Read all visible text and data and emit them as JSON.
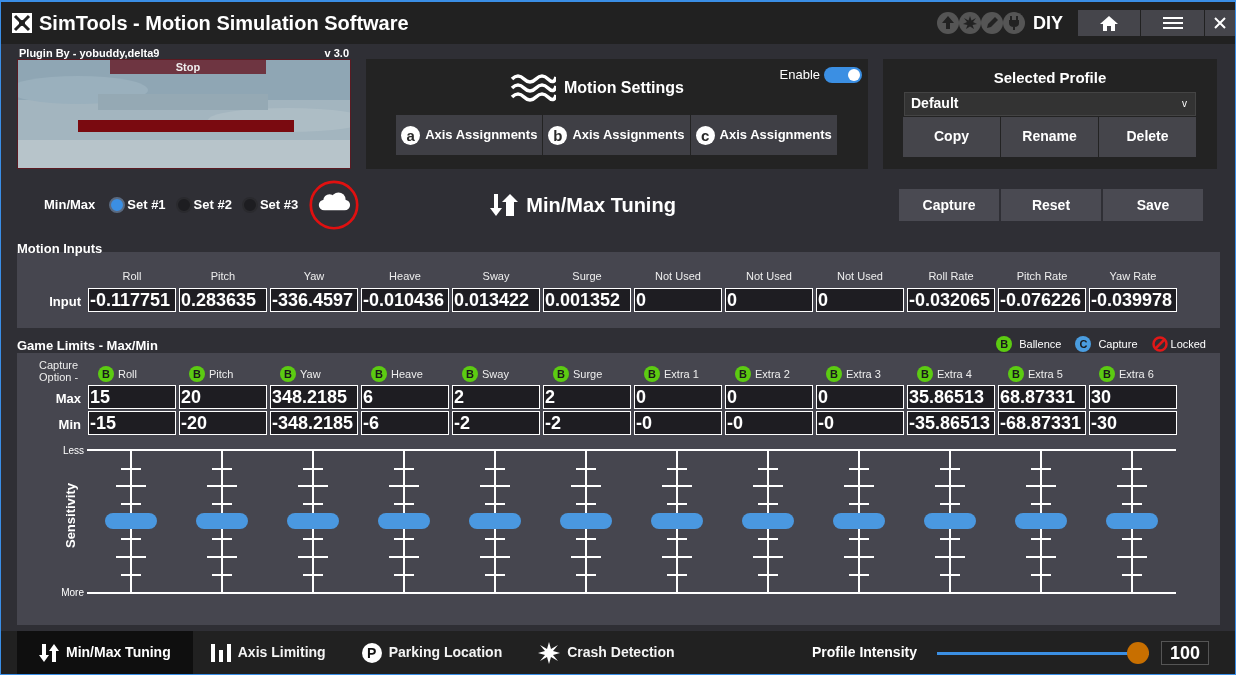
{
  "window": {
    "title": "SimTools - Motion Simulation Software",
    "mode": "DIY"
  },
  "game": {
    "plugin_by": "Plugin By - yobuddy,delta9",
    "version": "v 3.0",
    "stop_button": "Stop",
    "kind": "picture"
  },
  "motion_settings": {
    "title": "Motion Settings",
    "enable": {
      "label": "Enable",
      "on": true
    },
    "axis_buttons": [
      {
        "badge": "a",
        "label": "Axis Assignments"
      },
      {
        "badge": "b",
        "label": "Axis Assignments"
      },
      {
        "badge": "c",
        "label": "Axis Assignments"
      }
    ]
  },
  "profile": {
    "title": "Selected Profile",
    "dropdown": {
      "value": "Default",
      "caret": "v"
    },
    "buttons": [
      "Copy",
      "Rename",
      "Delete"
    ]
  },
  "min_max": {
    "label": "Min/Max",
    "sets": [
      {
        "label": "Set #1",
        "selected": true
      },
      {
        "label": "Set #2",
        "selected": false
      },
      {
        "label": "Set #3",
        "selected": false
      }
    ]
  },
  "section_title": "Min/Max Tuning",
  "actions": [
    "Capture",
    "Reset",
    "Save"
  ],
  "motion_inputs": {
    "title": "Motion Inputs",
    "row_label": "Input",
    "columns": [
      {
        "label": "Roll",
        "value": "-0.117751"
      },
      {
        "label": "Pitch",
        "value": "0.283635"
      },
      {
        "label": "Yaw",
        "value": "-336.4597"
      },
      {
        "label": "Heave",
        "value": "-0.010436"
      },
      {
        "label": "Sway",
        "value": "0.013422"
      },
      {
        "label": "Surge",
        "value": "0.001352"
      },
      {
        "label": "Not Used",
        "value": "0"
      },
      {
        "label": "Not Used",
        "value": "0"
      },
      {
        "label": "Not Used",
        "value": "0"
      },
      {
        "label": "Roll Rate",
        "value": "-0.032065"
      },
      {
        "label": "Pitch Rate",
        "value": "-0.076226"
      },
      {
        "label": "Yaw Rate",
        "value": "-0.039978"
      }
    ]
  },
  "game_limits": {
    "title": "Game Limits - Max/Min",
    "legend": [
      {
        "kind": "ballence",
        "badge": "B",
        "label": "Ballence"
      },
      {
        "kind": "capture",
        "badge": "C",
        "label": "Capture"
      },
      {
        "kind": "locked",
        "label": "Locked"
      }
    ],
    "capture_option_label": "Capture Option -",
    "max_label": "Max",
    "min_label": "Min",
    "less_label": "Less",
    "more_label": "More",
    "sensitivity_label": "Sensitivity",
    "columns": [
      {
        "label": "Roll",
        "option": "B",
        "kind": "ballence",
        "max": "15",
        "min": "-15",
        "level": 0.5
      },
      {
        "label": "Pitch",
        "option": "B",
        "kind": "ballence",
        "max": "20",
        "min": "-20",
        "level": 0.5
      },
      {
        "label": "Yaw",
        "option": "B",
        "kind": "ballence",
        "max": "348.2185",
        "min": "-348.2185",
        "level": 0.5
      },
      {
        "label": "Heave",
        "option": "B",
        "kind": "ballence",
        "max": "6",
        "min": "-6",
        "level": 0.5
      },
      {
        "label": "Sway",
        "option": "B",
        "kind": "ballence",
        "max": "2",
        "min": "-2",
        "level": 0.5
      },
      {
        "label": "Surge",
        "option": "B",
        "kind": "ballence",
        "max": "2",
        "min": "-2",
        "level": 0.5
      },
      {
        "label": "Extra 1",
        "option": "B",
        "kind": "ballence",
        "max": "0",
        "min": "-0",
        "level": 0.5
      },
      {
        "label": "Extra 2",
        "option": "B",
        "kind": "ballence",
        "max": "0",
        "min": "-0",
        "level": 0.5
      },
      {
        "label": "Extra 3",
        "option": "B",
        "kind": "ballence",
        "max": "0",
        "min": "-0",
        "level": 0.5
      },
      {
        "label": "Extra 4",
        "option": "B",
        "kind": "ballence",
        "max": "35.86513",
        "min": "-35.86513",
        "level": 0.5
      },
      {
        "label": "Extra 5",
        "option": "B",
        "kind": "ballence",
        "max": "68.87331",
        "min": "-68.87331",
        "level": 0.5
      },
      {
        "label": "Extra 6",
        "option": "B",
        "kind": "ballence",
        "max": "30",
        "min": "-30",
        "level": 0.5
      }
    ]
  },
  "bottom_tabs": [
    {
      "kind": "arrows",
      "label": "Min/Max Tuning",
      "selected": true
    },
    {
      "kind": "bars",
      "label": "Axis Limiting",
      "selected": false
    },
    {
      "kind": "parking",
      "badge": "P",
      "label": "Parking Location",
      "selected": false
    },
    {
      "kind": "burst",
      "label": "Crash Detection",
      "selected": false
    }
  ],
  "intensity": {
    "label": "Profile Intensity",
    "level": 1,
    "value": "100"
  }
}
